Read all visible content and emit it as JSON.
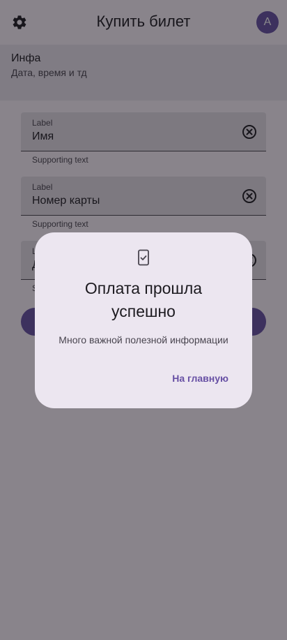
{
  "app_bar": {
    "title": "Купить билет",
    "settings_icon": "gear-icon",
    "avatar_letter": "A"
  },
  "info": {
    "title": "Инфа",
    "subtitle": "Дата, время и тд"
  },
  "fields": [
    {
      "label": "Label",
      "value": "Имя",
      "supporting": "Supporting text",
      "trailing_icon": "clear-icon"
    },
    {
      "label": "Label",
      "value": "Номер карты",
      "supporting": "Supporting text",
      "trailing_icon": "clear-icon"
    },
    {
      "label": "L",
      "value": "Д",
      "supporting": "S",
      "trailing_icon": "clear-icon"
    }
  ],
  "dialog": {
    "icon": "phone-check-icon",
    "title_line1": "Оплата прошла",
    "title_line2": "успешно",
    "text": "Много важной полезной информации",
    "action": "На главную"
  },
  "colors": {
    "primary": "#6750a4",
    "surface": "#fef7ff",
    "surface_container": "#ece6f0",
    "field_fill": "#e6e0e9",
    "on_surface": "#1d1b20",
    "on_surface_variant": "#49454f",
    "scrim": "rgba(20,18,24,0.5)"
  }
}
